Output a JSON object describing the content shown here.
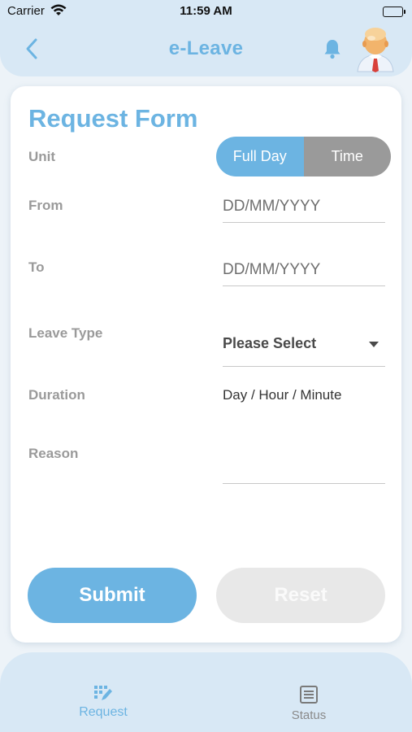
{
  "status_bar": {
    "carrier": "Carrier",
    "time": "11:59 AM",
    "battery_level": 1.0
  },
  "header": {
    "title": "e-Leave",
    "back_icon": "chevron-left-icon",
    "bell_icon": "bell-icon",
    "avatar": "user-avatar"
  },
  "form": {
    "title": "Request Form",
    "unit": {
      "label": "Unit",
      "options": [
        "Full Day",
        "Time"
      ],
      "selected": "Full Day"
    },
    "from": {
      "label": "From",
      "placeholder": "DD/MM/YYYY"
    },
    "to": {
      "label": "To",
      "placeholder": "DD/MM/YYYY"
    },
    "leave_type": {
      "label": "Leave Type",
      "value": "Please Select"
    },
    "duration": {
      "label": "Duration",
      "value": "Day / Hour / Minute"
    },
    "reason": {
      "label": "Reason",
      "value": ""
    },
    "submit_label": "Submit",
    "reset_label": "Reset"
  },
  "tabs": [
    {
      "label": "Request",
      "icon": "request-icon",
      "active": true
    },
    {
      "label": "Status",
      "icon": "status-list-icon",
      "active": false
    }
  ],
  "colors": {
    "accent": "#6cb4e2",
    "header_bg": "#d8e8f5",
    "inactive": "#9a9a9a"
  }
}
